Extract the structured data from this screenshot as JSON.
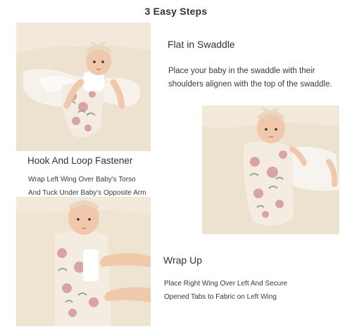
{
  "title": "3 Easy Steps",
  "steps": [
    {
      "heading": "Flat in Swaddle",
      "lines": [
        "Place your baby in the swaddle with their",
        "shoulders alignen with the top of the swaddle."
      ]
    },
    {
      "heading": "Hook And Loop Fastener",
      "lines": [
        "Wrap Left Wing Over Baby's Torso",
        "And Tuck Under Baby's Opposite Arm"
      ]
    },
    {
      "heading": "Wrap Up",
      "lines": [
        "Place Right Wing Over Left And Secure",
        "Opened Tabs to Fabric on Left Wing"
      ]
    }
  ],
  "colors": {
    "background": "#ede1cf",
    "swaddle": "#f4ece0",
    "floral_pink": "#d9a3a6",
    "floral_green": "#9aa585",
    "skin": "#f0c9ac"
  }
}
